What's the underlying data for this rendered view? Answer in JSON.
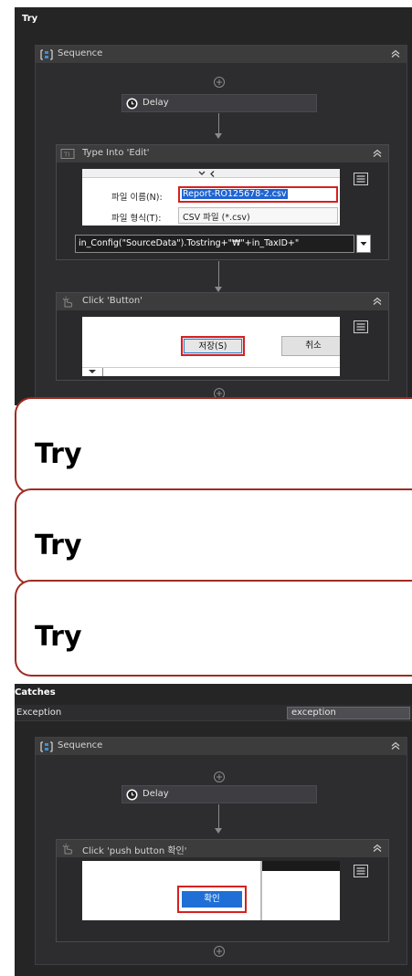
{
  "try_panel": {
    "title": "Try",
    "sequence_label": "Sequence",
    "delay_label": "Delay",
    "type_into": {
      "title": "Type Into 'Edit'",
      "filename_label": "파일 이름(N):",
      "filename_value": "Report-RO125678-2.csv",
      "filetype_label": "파일 형식(T):",
      "filetype_value": "CSV 파일 (*.csv)",
      "expression": "in_Config(\"SourceData\").Tostring+\"₩\"+in_TaxID+\""
    },
    "click_button": {
      "title": "Click 'Button'",
      "save_label": "저장(S)",
      "cancel_label": "취소"
    }
  },
  "overlay_cards": [
    {
      "label": "Try"
    },
    {
      "label": "Try"
    },
    {
      "label": "Try"
    }
  ],
  "catch_panel": {
    "title": "Catches",
    "exception_label": "Exception",
    "exception_var": "exception",
    "sequence_label": "Sequence",
    "delay_label": "Delay",
    "click_push": {
      "title": "Click 'push button  확인'",
      "ok_label": "확인"
    }
  },
  "colors": {
    "panel_bg": "#252526",
    "header_bg": "#3c3c3c",
    "highlight_red": "#d62020",
    "selection_blue": "#1e64d2",
    "card_border": "#a02b21"
  }
}
